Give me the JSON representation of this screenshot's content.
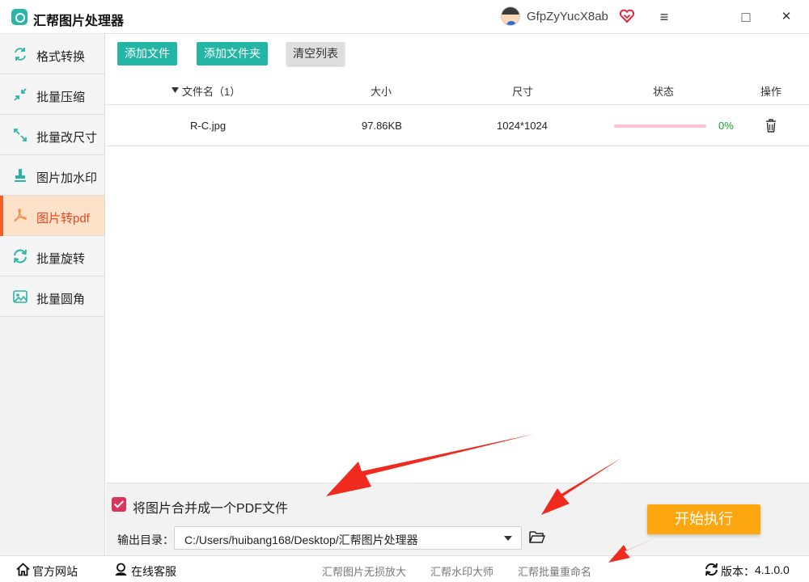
{
  "app": {
    "title": "汇帮图片处理器",
    "username": "GfpZyYucX8ab",
    "window_controls": {
      "menu": "≡",
      "maximize": "□",
      "close": "✕"
    }
  },
  "sidebar": {
    "items": [
      {
        "label": "格式转换",
        "icon": "convert-icon",
        "active": false
      },
      {
        "label": "批量压缩",
        "icon": "compress-icon",
        "active": false
      },
      {
        "label": "批量改尺寸",
        "icon": "resize-icon",
        "active": false
      },
      {
        "label": "图片加水印",
        "icon": "stamp-icon",
        "active": false
      },
      {
        "label": "图片转pdf",
        "icon": "pdf-icon",
        "active": true
      },
      {
        "label": "批量旋转",
        "icon": "rotate-icon",
        "active": false
      },
      {
        "label": "批量圆角",
        "icon": "image-icon",
        "active": false
      }
    ]
  },
  "toolbar": {
    "add_file": "添加文件",
    "add_folder": "添加文件夹",
    "clear_list": "清空列表"
  },
  "table": {
    "columns": [
      "文件名（1）",
      "大小",
      "尺寸",
      "状态",
      "操作"
    ],
    "rows": [
      {
        "name": "R-C.jpg",
        "size": "97.86KB",
        "dimensions": "1024*1024",
        "progress_percent": 0,
        "status_text": "0%"
      }
    ]
  },
  "options": {
    "merge_checked": true,
    "merge_label": "将图片合并成一个PDF文件",
    "output_label": "输出目录：",
    "output_path": "C:/Users/huibang168/Desktop/汇帮图片处理器",
    "start_button": "开始执行"
  },
  "footer": {
    "website": "官方网站",
    "support": "在线客服",
    "links": [
      "汇帮图片无损放大",
      "汇帮水印大师",
      "汇帮批量重命名"
    ],
    "version_label": "版本：",
    "version": "4.1.0.0"
  },
  "colors": {
    "accent_teal": "#23b6a5",
    "active_item_bg": "#fde1c9",
    "active_text": "#e8471c",
    "start_button": "#fca70f",
    "progress_track": "#f9c3d3",
    "percent_text": "#1e9e30",
    "annotation_arrow": "#f02a1e"
  }
}
